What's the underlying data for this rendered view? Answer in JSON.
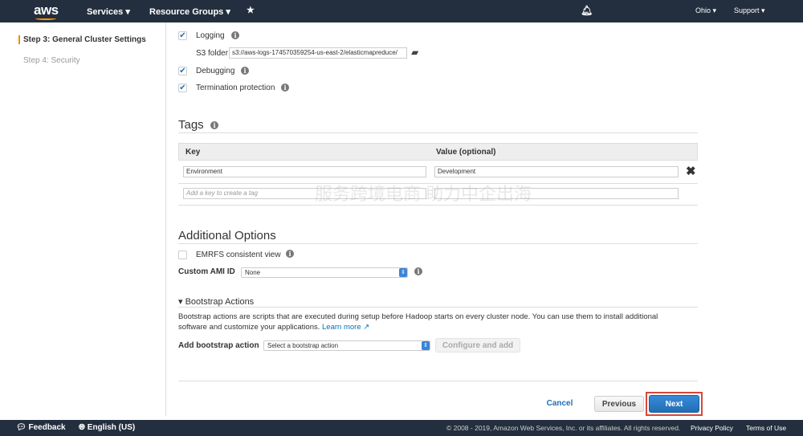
{
  "topbar": {
    "logo": "aws",
    "services": "Services",
    "resource_groups": "Resource Groups",
    "region": "Ohio",
    "support": "Support"
  },
  "sidebar": {
    "steps": [
      {
        "label": "Step 3: General Cluster Settings",
        "active": true
      },
      {
        "label": "Step 4: Security",
        "active": false
      }
    ]
  },
  "logging": {
    "label": "Logging",
    "checked": true,
    "s3_label": "S3 folder",
    "s3_value": "s3://aws-logs-174570359254-us-east-2/elasticmapreduce/"
  },
  "debugging": {
    "label": "Debugging",
    "checked": true
  },
  "termination": {
    "label": "Termination protection",
    "checked": true
  },
  "tags": {
    "title": "Tags",
    "col_key": "Key",
    "col_value": "Value (optional)",
    "rows": [
      {
        "key": "Environment",
        "value": "Development"
      }
    ],
    "key_placeholder": "Add a key to create a tag"
  },
  "additional": {
    "title": "Additional Options",
    "emrfs_label": "EMRFS consistent view",
    "emrfs_checked": false,
    "ami_label": "Custom AMI ID",
    "ami_value": "None"
  },
  "bootstrap": {
    "title": "Bootstrap Actions",
    "description_1": "Bootstrap actions are scripts that are executed during setup before Hadoop starts on every cluster node. You can use them to install additional",
    "description_2": "software and customize your applications.",
    "learn_more": "Learn more",
    "add_label": "Add bootstrap action",
    "select_value": "Select a bootstrap action",
    "configure_button": "Configure and add"
  },
  "actions": {
    "cancel": "Cancel",
    "previous": "Previous",
    "next": "Next"
  },
  "footer": {
    "feedback": "Feedback",
    "language": "English (US)",
    "copyright": "© 2008 - 2019, Amazon Web Services, Inc. or its affiliates. All rights reserved.",
    "privacy": "Privacy Policy",
    "terms": "Terms of Use"
  },
  "watermark": {
    "line1": "服务跨境电商",
    "line2": "助力中企出海"
  }
}
